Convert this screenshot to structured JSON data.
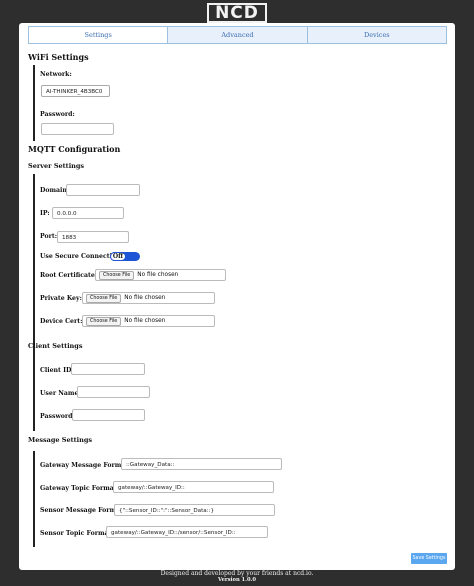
{
  "logo": "NCD",
  "tabs": [
    "Settings",
    "Advanced",
    "Devices"
  ],
  "wifi": {
    "title": "WiFi Settings",
    "network_label": "Network:",
    "network_value": "AI-THINKER_4B3BC0",
    "password_label": "Password:",
    "password_value": ""
  },
  "mqtt": {
    "title": "MQTT Configuration",
    "server_title": "Server Settings",
    "domain_label": "Domain:",
    "domain_value": "",
    "ip_label": "IP:",
    "ip_value": "0.0.0.0",
    "port_label": "Port:",
    "port_value": "1883",
    "secure_label": "Use Secure Connection:",
    "secure_state": "Off",
    "root_cert_label": "Root Certificate:",
    "private_key_label": "Private Key:",
    "device_cert_label": "Device Cert:",
    "choose_file": "Choose File",
    "no_file": "No file chosen",
    "client_title": "Client Settings",
    "client_id_label": "Client ID:",
    "client_id_value": "",
    "username_label": "User Name:",
    "username_value": "",
    "client_password_label": "Password:",
    "client_password_value": "",
    "message_title": "Message Settings",
    "gw_msg_label": "Gateway Message Format:",
    "gw_msg_value": "::Gateway_Data::",
    "gw_topic_label": "Gateway Topic Format:",
    "gw_topic_value": "gateway/::Gateway_ID::",
    "sensor_msg_label": "Sensor Message Format:",
    "sensor_msg_value": "{\"::Sensor_ID::\":\"::Sensor_Data::}",
    "sensor_topic_label": "Sensor Topic Format:",
    "sensor_topic_value": "gateway/::Gateway_ID::/sensor/::Sensor_ID::"
  },
  "save_label": "Save Settings",
  "footer": {
    "credit": "Designed and developed by your friends at ncd.io.",
    "version": "Version 1.0.0"
  }
}
